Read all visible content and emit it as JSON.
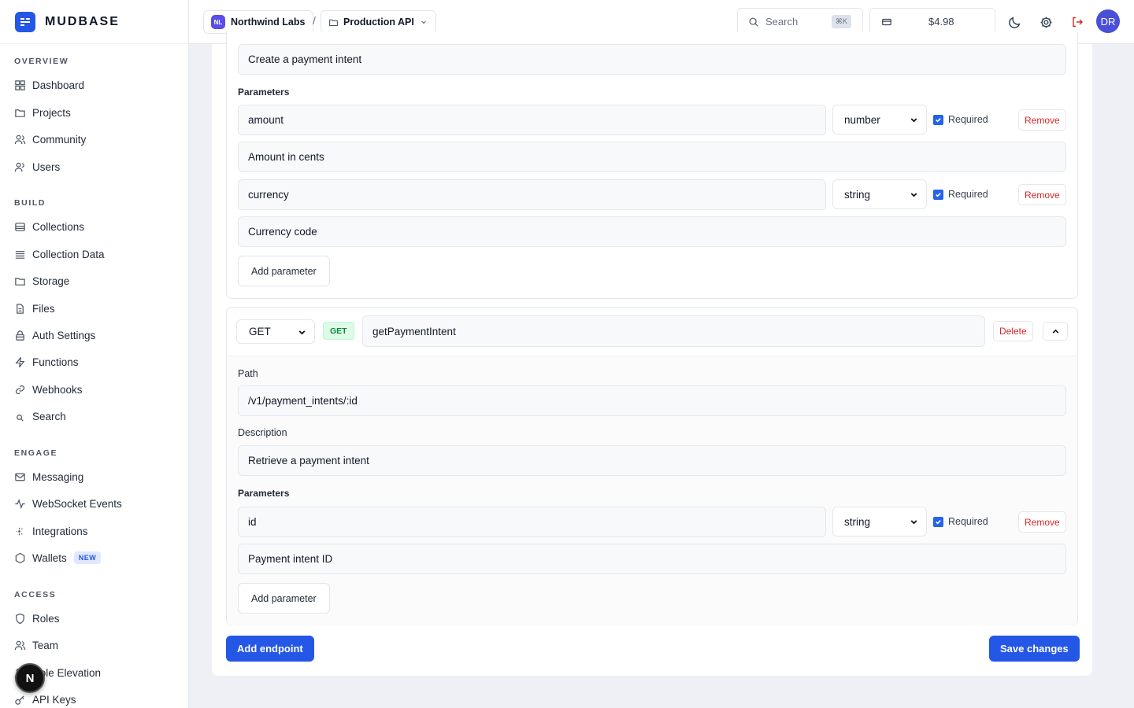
{
  "brand": {
    "name": "MUDBASE"
  },
  "sidebar": {
    "sections": [
      {
        "title": "OVERVIEW",
        "items": [
          {
            "label": "Dashboard",
            "icon": "grid-icon"
          },
          {
            "label": "Projects",
            "icon": "folder-icon"
          },
          {
            "label": "Community",
            "icon": "users-icon"
          },
          {
            "label": "Users",
            "icon": "user-icon"
          }
        ]
      },
      {
        "title": "BUILD",
        "items": [
          {
            "label": "Collections",
            "icon": "database-icon"
          },
          {
            "label": "Collection Data",
            "icon": "rows-icon"
          },
          {
            "label": "Storage",
            "icon": "folder-icon"
          },
          {
            "label": "Files",
            "icon": "file-icon"
          },
          {
            "label": "Auth Settings",
            "icon": "lock-icon"
          },
          {
            "label": "Functions",
            "icon": "bolt-icon"
          },
          {
            "label": "Webhooks",
            "icon": "link-icon"
          },
          {
            "label": "Search",
            "icon": "search-icon"
          }
        ]
      },
      {
        "title": "ENGAGE",
        "items": [
          {
            "label": "Messaging",
            "icon": "mail-icon"
          },
          {
            "label": "WebSocket Events",
            "icon": "activity-icon"
          },
          {
            "label": "Integrations",
            "icon": "sparkle-icon"
          },
          {
            "label": "Wallets",
            "icon": "hexagon-icon",
            "badge": "NEW"
          }
        ]
      },
      {
        "title": "ACCESS",
        "items": [
          {
            "label": "Roles",
            "icon": "shield-icon"
          },
          {
            "label": "Team",
            "icon": "users-icon"
          },
          {
            "label": "Role Elevation",
            "icon": "user-icon"
          },
          {
            "label": "API Keys",
            "icon": "key-icon"
          }
        ]
      }
    ],
    "floating_button": "N"
  },
  "header": {
    "org": {
      "initials": "NL",
      "name": "Northwind Labs"
    },
    "separator": "/",
    "project": "Production API",
    "search": {
      "placeholder": "Search",
      "shortcut": "⌘K"
    },
    "balance": "$4.98",
    "avatar_initials": "DR"
  },
  "endpoint1": {
    "description": "Create a payment intent",
    "parameters_label": "Parameters",
    "params": [
      {
        "name": "amount",
        "type": "number",
        "required_label": "Required",
        "description": "Amount in cents",
        "remove": "Remove"
      },
      {
        "name": "currency",
        "type": "string",
        "required_label": "Required",
        "description": "Currency code",
        "remove": "Remove"
      }
    ],
    "add_parameter": "Add parameter"
  },
  "endpoint2": {
    "method": "GET",
    "method_tag": "GET",
    "name": "getPaymentIntent",
    "delete": "Delete",
    "path_label": "Path",
    "path": "/v1/payment_intents/:id",
    "description_label": "Description",
    "description": "Retrieve a payment intent",
    "parameters_label": "Parameters",
    "params": [
      {
        "name": "id",
        "type": "string",
        "required_label": "Required",
        "description": "Payment intent ID",
        "remove": "Remove"
      }
    ],
    "add_parameter": "Add parameter"
  },
  "footer": {
    "add_endpoint": "Add endpoint",
    "save": "Save changes"
  },
  "colors": {
    "primary": "#2457e6",
    "danger": "#dc2626",
    "success": "#15803d"
  }
}
